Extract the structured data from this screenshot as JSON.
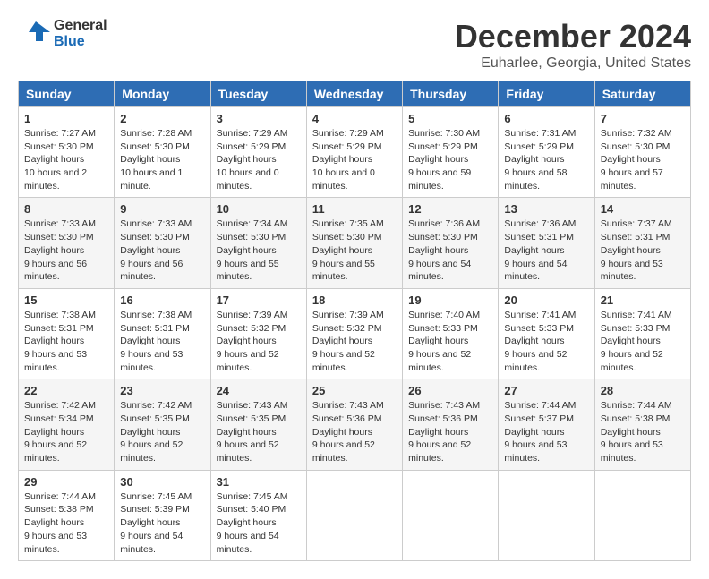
{
  "header": {
    "logo_line1": "General",
    "logo_line2": "Blue",
    "month_title": "December 2024",
    "location": "Euharlee, Georgia, United States"
  },
  "days_of_week": [
    "Sunday",
    "Monday",
    "Tuesday",
    "Wednesday",
    "Thursday",
    "Friday",
    "Saturday"
  ],
  "weeks": [
    [
      {
        "day": "1",
        "sunrise": "7:27 AM",
        "sunset": "5:30 PM",
        "daylight": "10 hours and 2 minutes."
      },
      {
        "day": "2",
        "sunrise": "7:28 AM",
        "sunset": "5:30 PM",
        "daylight": "10 hours and 1 minute."
      },
      {
        "day": "3",
        "sunrise": "7:29 AM",
        "sunset": "5:29 PM",
        "daylight": "10 hours and 0 minutes."
      },
      {
        "day": "4",
        "sunrise": "7:29 AM",
        "sunset": "5:29 PM",
        "daylight": "10 hours and 0 minutes."
      },
      {
        "day": "5",
        "sunrise": "7:30 AM",
        "sunset": "5:29 PM",
        "daylight": "9 hours and 59 minutes."
      },
      {
        "day": "6",
        "sunrise": "7:31 AM",
        "sunset": "5:29 PM",
        "daylight": "9 hours and 58 minutes."
      },
      {
        "day": "7",
        "sunrise": "7:32 AM",
        "sunset": "5:30 PM",
        "daylight": "9 hours and 57 minutes."
      }
    ],
    [
      {
        "day": "8",
        "sunrise": "7:33 AM",
        "sunset": "5:30 PM",
        "daylight": "9 hours and 56 minutes."
      },
      {
        "day": "9",
        "sunrise": "7:33 AM",
        "sunset": "5:30 PM",
        "daylight": "9 hours and 56 minutes."
      },
      {
        "day": "10",
        "sunrise": "7:34 AM",
        "sunset": "5:30 PM",
        "daylight": "9 hours and 55 minutes."
      },
      {
        "day": "11",
        "sunrise": "7:35 AM",
        "sunset": "5:30 PM",
        "daylight": "9 hours and 55 minutes."
      },
      {
        "day": "12",
        "sunrise": "7:36 AM",
        "sunset": "5:30 PM",
        "daylight": "9 hours and 54 minutes."
      },
      {
        "day": "13",
        "sunrise": "7:36 AM",
        "sunset": "5:31 PM",
        "daylight": "9 hours and 54 minutes."
      },
      {
        "day": "14",
        "sunrise": "7:37 AM",
        "sunset": "5:31 PM",
        "daylight": "9 hours and 53 minutes."
      }
    ],
    [
      {
        "day": "15",
        "sunrise": "7:38 AM",
        "sunset": "5:31 PM",
        "daylight": "9 hours and 53 minutes."
      },
      {
        "day": "16",
        "sunrise": "7:38 AM",
        "sunset": "5:31 PM",
        "daylight": "9 hours and 53 minutes."
      },
      {
        "day": "17",
        "sunrise": "7:39 AM",
        "sunset": "5:32 PM",
        "daylight": "9 hours and 52 minutes."
      },
      {
        "day": "18",
        "sunrise": "7:39 AM",
        "sunset": "5:32 PM",
        "daylight": "9 hours and 52 minutes."
      },
      {
        "day": "19",
        "sunrise": "7:40 AM",
        "sunset": "5:33 PM",
        "daylight": "9 hours and 52 minutes."
      },
      {
        "day": "20",
        "sunrise": "7:41 AM",
        "sunset": "5:33 PM",
        "daylight": "9 hours and 52 minutes."
      },
      {
        "day": "21",
        "sunrise": "7:41 AM",
        "sunset": "5:33 PM",
        "daylight": "9 hours and 52 minutes."
      }
    ],
    [
      {
        "day": "22",
        "sunrise": "7:42 AM",
        "sunset": "5:34 PM",
        "daylight": "9 hours and 52 minutes."
      },
      {
        "day": "23",
        "sunrise": "7:42 AM",
        "sunset": "5:35 PM",
        "daylight": "9 hours and 52 minutes."
      },
      {
        "day": "24",
        "sunrise": "7:43 AM",
        "sunset": "5:35 PM",
        "daylight": "9 hours and 52 minutes."
      },
      {
        "day": "25",
        "sunrise": "7:43 AM",
        "sunset": "5:36 PM",
        "daylight": "9 hours and 52 minutes."
      },
      {
        "day": "26",
        "sunrise": "7:43 AM",
        "sunset": "5:36 PM",
        "daylight": "9 hours and 52 minutes."
      },
      {
        "day": "27",
        "sunrise": "7:44 AM",
        "sunset": "5:37 PM",
        "daylight": "9 hours and 53 minutes."
      },
      {
        "day": "28",
        "sunrise": "7:44 AM",
        "sunset": "5:38 PM",
        "daylight": "9 hours and 53 minutes."
      }
    ],
    [
      {
        "day": "29",
        "sunrise": "7:44 AM",
        "sunset": "5:38 PM",
        "daylight": "9 hours and 53 minutes."
      },
      {
        "day": "30",
        "sunrise": "7:45 AM",
        "sunset": "5:39 PM",
        "daylight": "9 hours and 54 minutes."
      },
      {
        "day": "31",
        "sunrise": "7:45 AM",
        "sunset": "5:40 PM",
        "daylight": "9 hours and 54 minutes."
      },
      null,
      null,
      null,
      null
    ]
  ]
}
